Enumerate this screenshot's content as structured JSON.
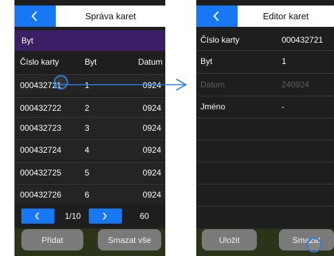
{
  "left": {
    "title": "Správa karet",
    "group": "Byt",
    "columns": [
      "Číslo karty",
      "Byt",
      "Datum"
    ],
    "rows": [
      {
        "card": "000432721",
        "flat": "1",
        "date": "0924"
      },
      {
        "card": "000432722",
        "flat": "2",
        "date": "0924"
      },
      {
        "card": "000432723",
        "flat": "3",
        "date": "0924"
      },
      {
        "card": "000432724",
        "flat": "4",
        "date": "0924"
      },
      {
        "card": "000432725",
        "flat": "5",
        "date": "0924"
      },
      {
        "card": "000432726",
        "flat": "6",
        "date": "0924"
      }
    ],
    "pager": {
      "page": "1/10",
      "total": "60"
    },
    "buttons": {
      "add": "Přidat",
      "delete_all": "Smazat vše"
    }
  },
  "right": {
    "title": "Editor karet",
    "fields": [
      {
        "label": "Číslo karty",
        "value": "000432721"
      },
      {
        "label": "Byt",
        "value": "1"
      },
      {
        "label": "Datum",
        "value": "240924"
      },
      {
        "label": "Jméno",
        "value": "-"
      }
    ],
    "buttons": {
      "save": "Uložit",
      "delete": "Smazat"
    }
  },
  "icons": [
    "chevron-left-icon",
    "chevron-right-icon",
    "arrow-right-icon"
  ],
  "colors": {
    "accent": "#1877f2",
    "group_bar": "#3a1e66",
    "screen_bg": "#1e1e1e",
    "footer": "#2b3318",
    "button": "#7a7a7a",
    "disabled_text": "#5e5e5e"
  }
}
